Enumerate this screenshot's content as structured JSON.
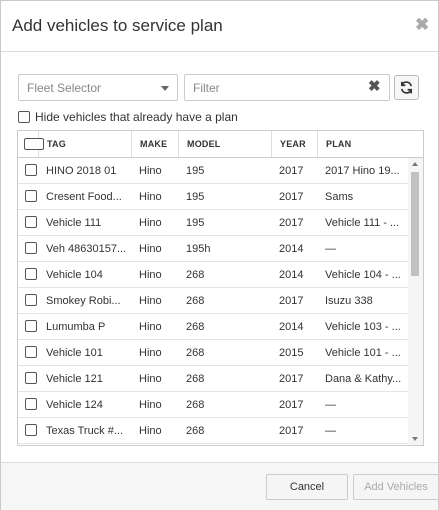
{
  "dialog": {
    "title": "Add vehicles to service plan",
    "close_icon": "✖"
  },
  "filters": {
    "fleet_placeholder": "Fleet Selector",
    "filter_placeholder": "Filter",
    "clear_icon": "✖",
    "refresh_icon": "refresh-icon"
  },
  "hide_option": {
    "label": "Hide vehicles that already have a plan",
    "checked": false
  },
  "table": {
    "columns": {
      "tag": "TAG",
      "make": "MAKE",
      "model": "MODEL",
      "year": "YEAR",
      "plan": "PLAN"
    },
    "rows": [
      {
        "tag": "HINO 2018 01",
        "make": "Hino",
        "model": "195",
        "year": "2017",
        "plan": "2017 Hino 19..."
      },
      {
        "tag": "Cresent Food...",
        "make": "Hino",
        "model": "195",
        "year": "2017",
        "plan": "Sams"
      },
      {
        "tag": "Vehicle 111",
        "make": "Hino",
        "model": "195",
        "year": "2017",
        "plan": "Vehicle 111 - ..."
      },
      {
        "tag": "Veh 48630157...",
        "make": "Hino",
        "model": "195h",
        "year": "2014",
        "plan": "—"
      },
      {
        "tag": "Vehicle 104",
        "make": "Hino",
        "model": "268",
        "year": "2014",
        "plan": "Vehicle 104 - ..."
      },
      {
        "tag": "Smokey Robi...",
        "make": "Hino",
        "model": "268",
        "year": "2017",
        "plan": "Isuzu 338"
      },
      {
        "tag": "Lumumba P",
        "make": "Hino",
        "model": "268",
        "year": "2014",
        "plan": "Vehicle 103 - ..."
      },
      {
        "tag": "Vehicle 101",
        "make": "Hino",
        "model": "268",
        "year": "2015",
        "plan": "Vehicle 101 - ..."
      },
      {
        "tag": "Vehicle 121",
        "make": "Hino",
        "model": "268",
        "year": "2017",
        "plan": "Dana & Kathy..."
      },
      {
        "tag": "Vehicle 124",
        "make": "Hino",
        "model": "268",
        "year": "2017",
        "plan": "—"
      },
      {
        "tag": "Texas Truck #...",
        "make": "Hino",
        "model": "268",
        "year": "2017",
        "plan": "—"
      }
    ]
  },
  "footer": {
    "cancel_label": "Cancel",
    "add_label": "Add Vehicles"
  }
}
